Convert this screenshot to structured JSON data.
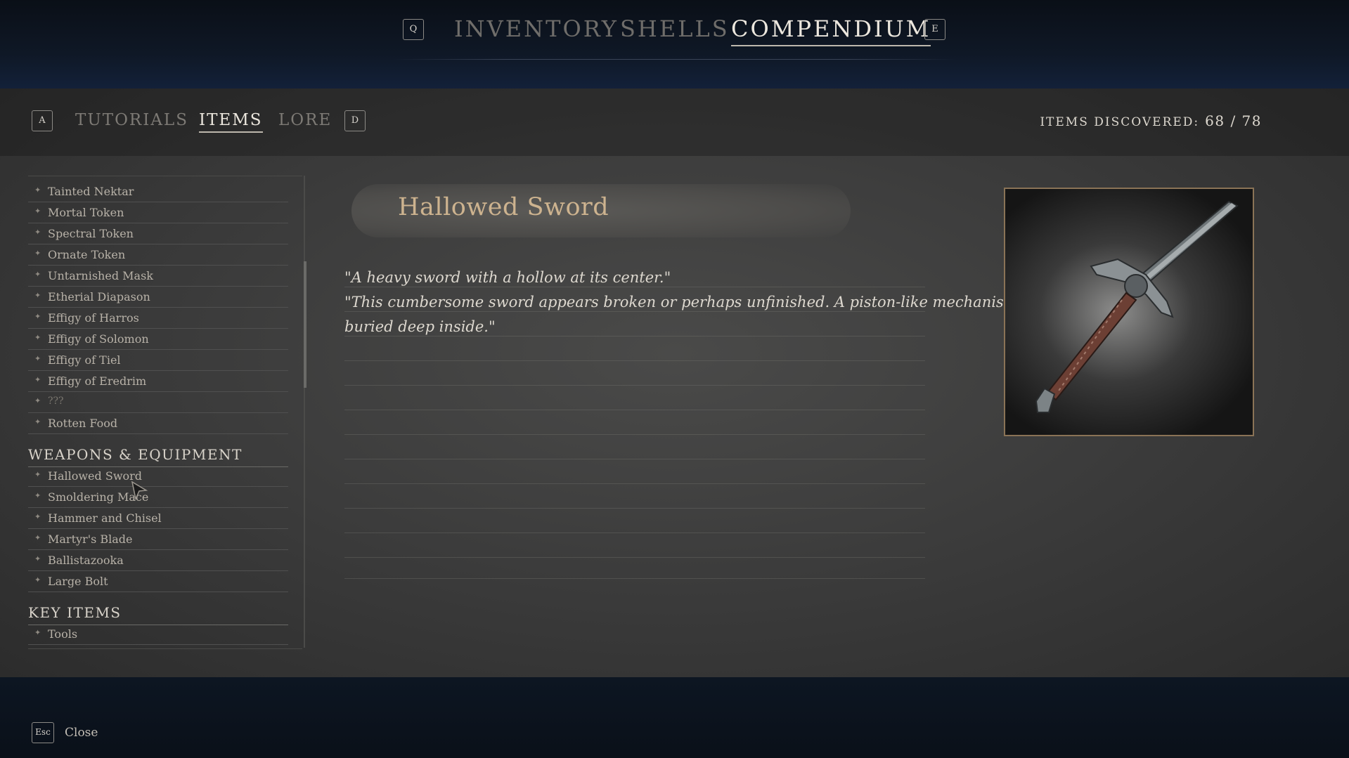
{
  "top_nav": {
    "left_key": "Q",
    "right_key": "E",
    "tabs": [
      {
        "label": "INVENTORY",
        "active": false
      },
      {
        "label": "SHELLS",
        "active": false
      },
      {
        "label": "COMPENDIUM",
        "active": true
      }
    ]
  },
  "sub_nav": {
    "left_key": "A",
    "right_key": "D",
    "tabs": [
      {
        "label": "TUTORIALS",
        "active": false
      },
      {
        "label": "ITEMS",
        "active": true
      },
      {
        "label": "LORE",
        "active": false
      }
    ],
    "discovered_label": "ITEMS DISCOVERED:",
    "discovered_value": "68 / 78"
  },
  "list": {
    "items_top": [
      "Tainted Nektar",
      "Mortal Token",
      "Spectral Token",
      "Ornate Token",
      "Untarnished Mask",
      "Etherial Diapason",
      "Effigy of Harros",
      "Effigy of Solomon",
      "Effigy of Tiel",
      "Effigy of Eredrim",
      "???",
      "Rotten Food"
    ],
    "section_weapons": "WEAPONS & EQUIPMENT",
    "weapons": [
      "Hallowed Sword",
      "Smoldering Mace",
      "Hammer and Chisel",
      "Martyr's Blade",
      "Ballistazooka",
      "Large Bolt"
    ],
    "section_key": "KEY ITEMS",
    "key_items": [
      "Tools"
    ]
  },
  "detail": {
    "title": "Hallowed Sword",
    "desc_lines": [
      "\"A heavy sword with a hollow at its center.\"",
      "\"This cumbersome sword appears broken or perhaps unfinished. A piston-like mechanism is",
      "buried deep inside.\""
    ]
  },
  "footer": {
    "key": "Esc",
    "label": "Close"
  },
  "colors": {
    "title_gold": "#cdb38f",
    "frame_border": "#8a7356",
    "panel": "#3a3a3a",
    "topbar": "#0f1826"
  }
}
